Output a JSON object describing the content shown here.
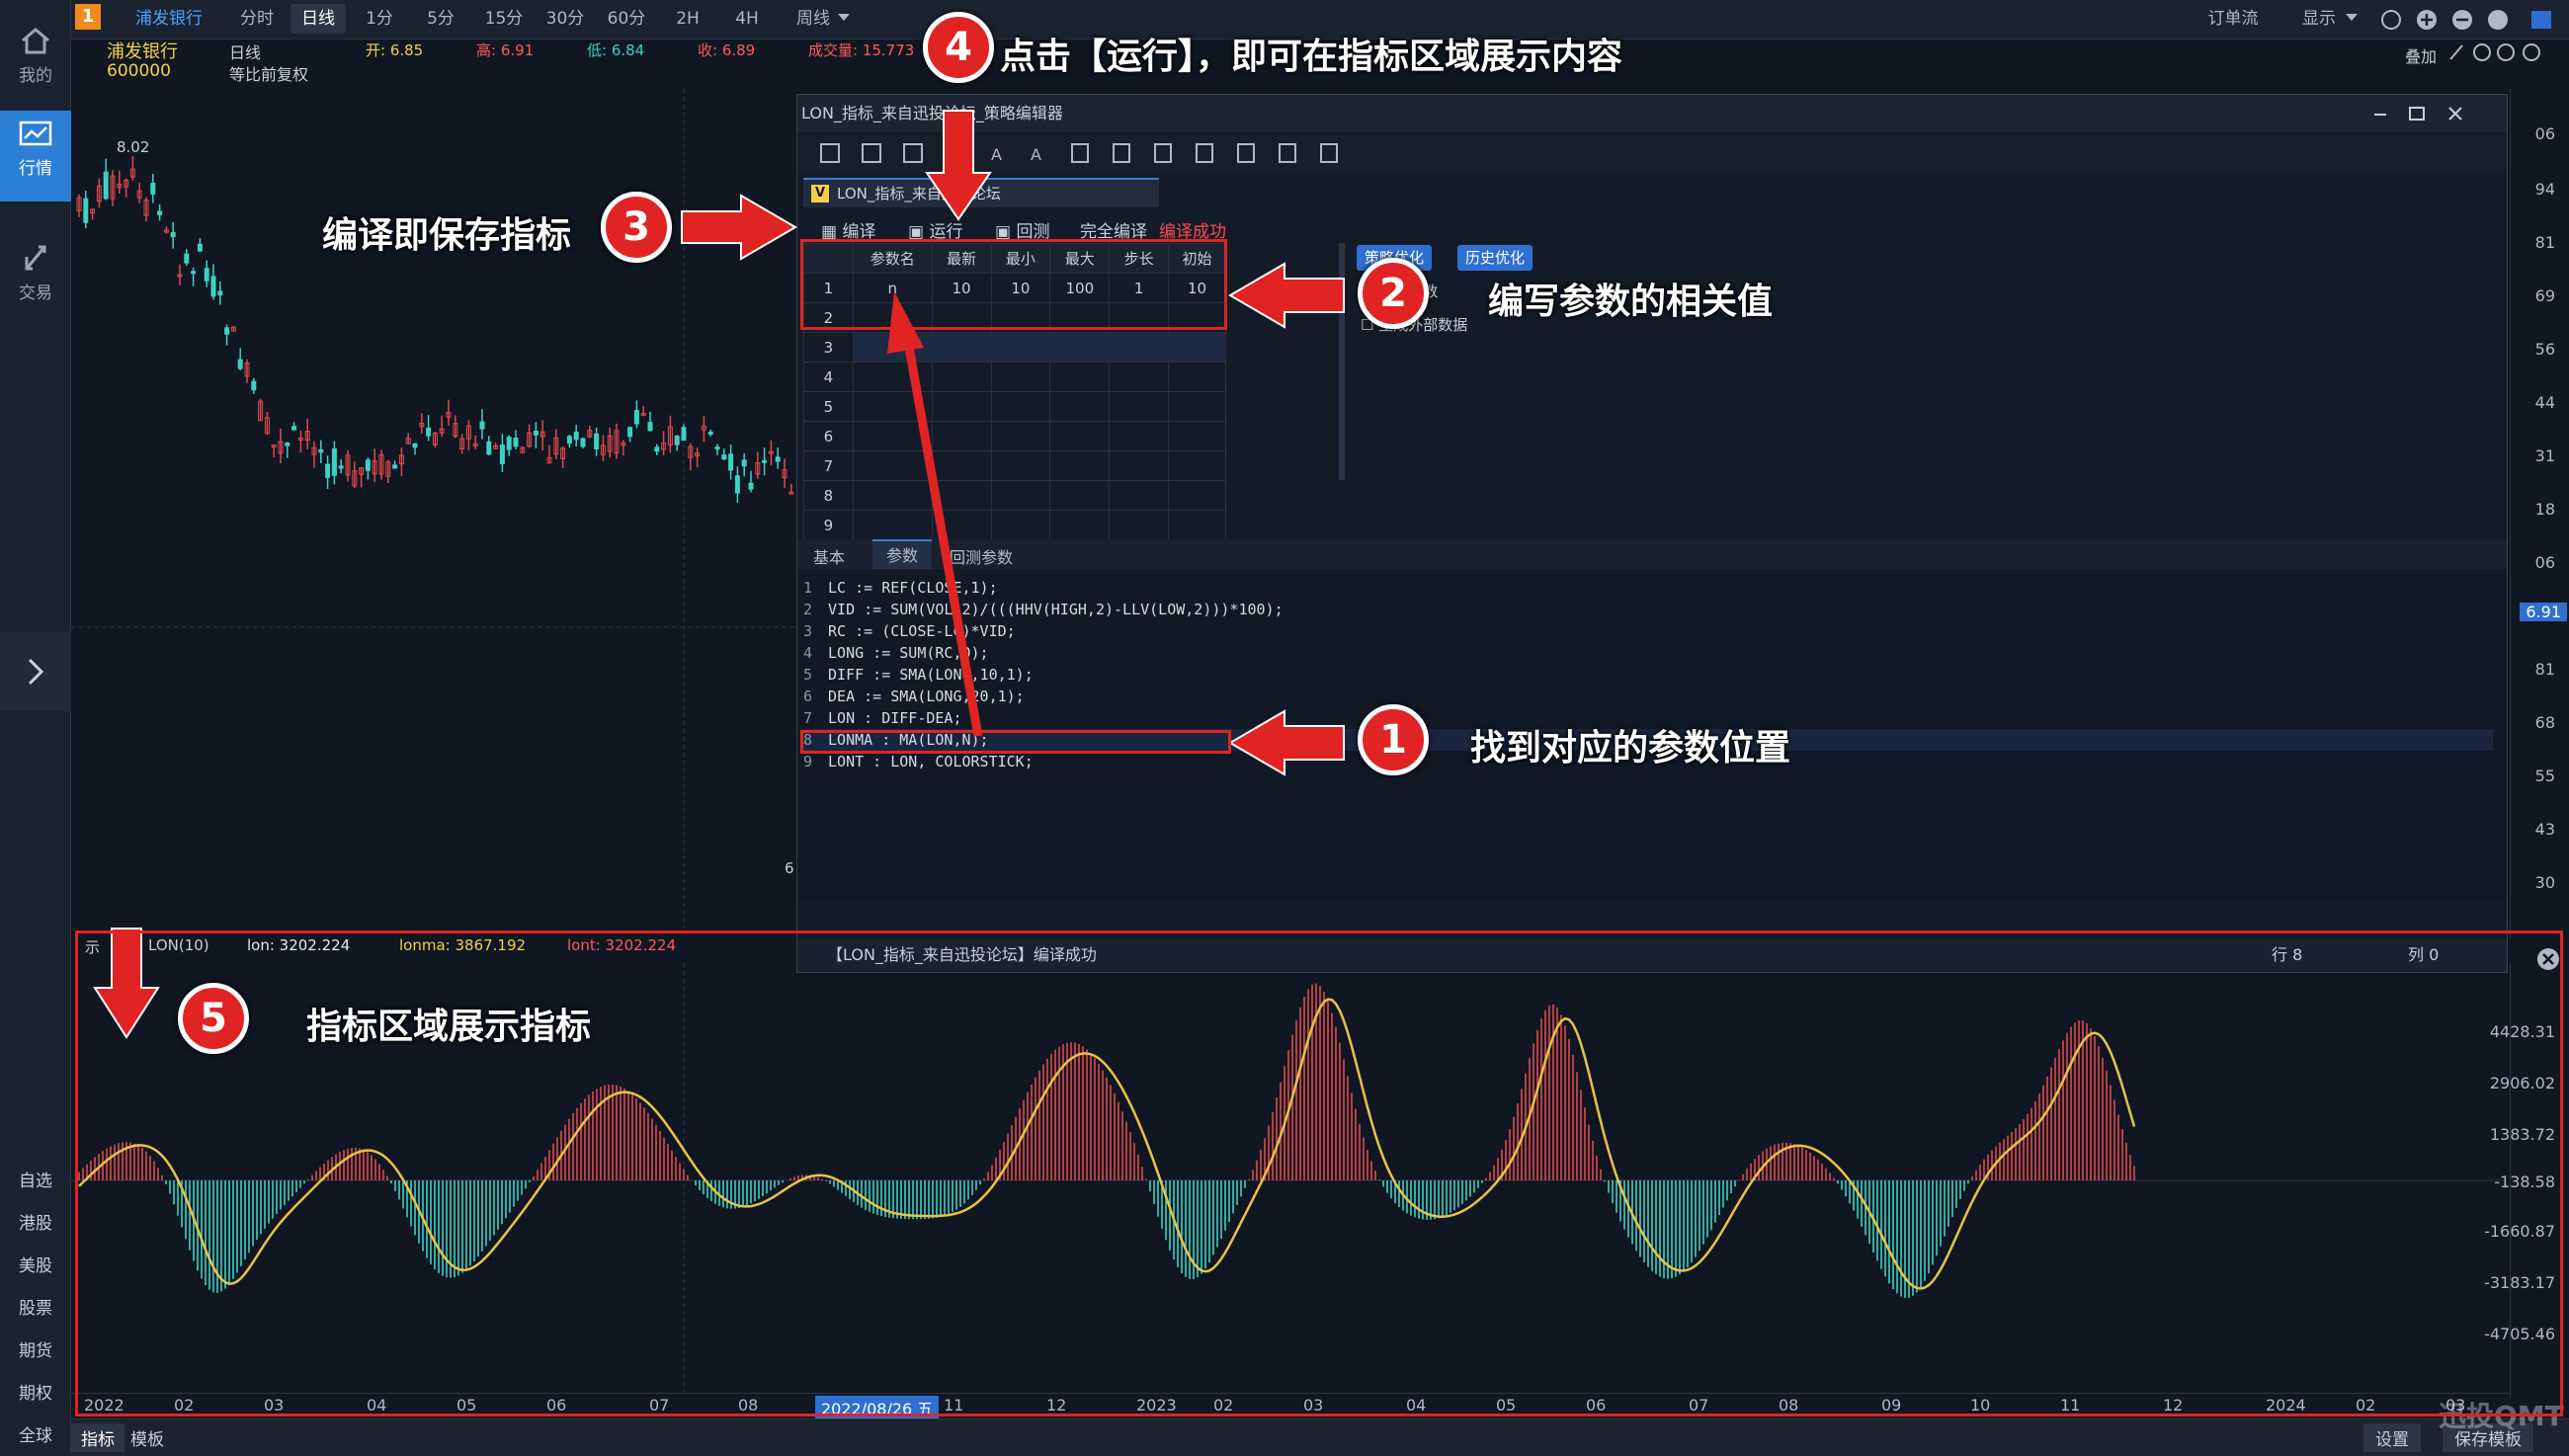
{
  "left_rail": {
    "items": [
      {
        "label": "我的",
        "icon": "home-icon"
      },
      {
        "label": "行情",
        "icon": "chart-icon"
      },
      {
        "label": "交易",
        "icon": "trade-icon"
      }
    ],
    "bottom": [
      "自选",
      "港股",
      "美股",
      "股票",
      "期货",
      "期权",
      "全球"
    ]
  },
  "topbar": {
    "logo": "1",
    "stock_tab": "浦发银行",
    "periods": [
      "分时",
      "日线",
      "1分",
      "5分",
      "15分",
      "30分",
      "60分",
      "2H",
      "4H",
      "周线"
    ],
    "selected_period": "日线",
    "right": [
      "订单流",
      "显示"
    ],
    "overlay_label": "叠加"
  },
  "quote": {
    "name": "浦发银行",
    "code": "600000",
    "period": "日线",
    "adjust": "等比前复权",
    "open": "开: 6.85",
    "high": "高: 6.91",
    "low": "低: 6.84",
    "close": "收: 6.89",
    "volume": "成交量: 15.773"
  },
  "chart_marks": {
    "peak": "8.02",
    "low_mark": "6"
  },
  "price_axis": [
    "06",
    "94",
    "81",
    "69",
    "56",
    "44",
    "31",
    "18",
    "06",
    "6.91",
    "81",
    "68",
    "55",
    "43",
    "30"
  ],
  "editor": {
    "title": "LON_指标_来自迅投论坛_策略编辑器",
    "tab": "LON_指标_来自迅投论坛",
    "actions": {
      "compile": "编译",
      "run": "运行",
      "backtest": "回测",
      "full_compile": "完全编译",
      "status": "编译成功"
    },
    "param_headers": [
      "参数名",
      "最新",
      "最小",
      "最大",
      "步长",
      "初始"
    ],
    "params": [
      {
        "idx": "1",
        "name": "n",
        "latest": "10",
        "min": "10",
        "max": "100",
        "step": "1",
        "init": "10"
      },
      {
        "idx": "2"
      },
      {
        "idx": "3"
      },
      {
        "idx": "4"
      },
      {
        "idx": "5"
      },
      {
        "idx": "6"
      },
      {
        "idx": "7"
      },
      {
        "idx": "8"
      },
      {
        "idx": "9"
      }
    ],
    "right_buttons": [
      "策略优化",
      "历史优化"
    ],
    "options": [
      "模型参数",
      "生成外部数据"
    ],
    "sub_tabs": [
      "基本",
      "参数",
      "回测参数"
    ],
    "code": [
      {
        "n": "1",
        "text": "LC := REF(CLOSE,1);"
      },
      {
        "n": "2",
        "text": "VID := SUM(VOL,2)/(((HHV(HIGH,2)-LLV(LOW,2)))*100);"
      },
      {
        "n": "3",
        "text": "RC := (CLOSE-LC)*VID;"
      },
      {
        "n": "4",
        "text": "LONG := SUM(RC,0);"
      },
      {
        "n": "5",
        "text": "DIFF := SMA(LONG,10,1);"
      },
      {
        "n": "6",
        "text": "DEA := SMA(LONG,20,1);"
      },
      {
        "n": "7",
        "text": "LON : DIFF-DEA;"
      },
      {
        "n": "8",
        "text": "LONMA : MA(LON,N);"
      },
      {
        "n": "9",
        "text": "LONT : LON, COLORSTICK;"
      }
    ],
    "status_msg": "【LON_指标_来自迅投论坛】编译成功",
    "row": "行 8",
    "col": "列 0"
  },
  "indicator": {
    "name": "LON(10)",
    "prefix": "示",
    "lon": "lon: 3202.224",
    "lonma": "lonma: 3867.192",
    "lont": "lont: 3202.224",
    "yaxis": [
      "4428.31",
      "2906.02",
      "1383.72",
      "-138.58",
      "-1660.87",
      "-3183.17",
      "-4705.46"
    ]
  },
  "x_axis": [
    {
      "label": "2022",
      "x": 0.01
    },
    {
      "label": "02",
      "x": 0.08
    },
    {
      "label": "03",
      "x": 0.15
    },
    {
      "label": "04",
      "x": 0.23
    },
    {
      "label": "05",
      "x": 0.3
    },
    {
      "label": "06",
      "x": 0.37
    },
    {
      "label": "07",
      "x": 0.45
    },
    {
      "label": "08",
      "x": 0.52
    },
    {
      "label": "2022/08/26 五",
      "x": 0.58
    },
    {
      "label": "11",
      "x": 0.68
    },
    {
      "label": "12",
      "x": 0.76
    },
    {
      "label": "2023",
      "x": 0.83
    },
    {
      "label": "02",
      "x": 0.89
    },
    {
      "label": "03",
      "x": 0.96
    },
    {
      "label": "04",
      "x": 1.04
    },
    {
      "label": "05",
      "x": 1.11
    },
    {
      "label": "06",
      "x": 1.18
    },
    {
      "label": "07",
      "x": 1.26
    },
    {
      "label": "08",
      "x": 1.33
    },
    {
      "label": "09",
      "x": 1.41
    },
    {
      "label": "10",
      "x": 1.48
    },
    {
      "label": "11",
      "x": 1.55
    },
    {
      "label": "12",
      "x": 1.63
    },
    {
      "label": "2024",
      "x": 1.71
    },
    {
      "label": "02",
      "x": 1.78
    },
    {
      "label": "03",
      "x": 1.85
    }
  ],
  "bottom_bar": {
    "tabs": [
      "指标",
      "模板"
    ],
    "right": [
      "设置",
      "保存模板"
    ],
    "watermark": "迅投QMT"
  },
  "annotations": {
    "step1": "找到对应的参数位置",
    "step2": "编写参数的相关值",
    "step3": "编译即保存指标",
    "step4": "点击【运行】，即可在指标区域展示内容",
    "step5": "指标区域展示指标"
  },
  "colors": {
    "up": "#e04a4a",
    "down": "#3fd0c4",
    "accent": "#2f6fd1",
    "annotation": "#e02424",
    "yellow": "#e8c24a"
  }
}
